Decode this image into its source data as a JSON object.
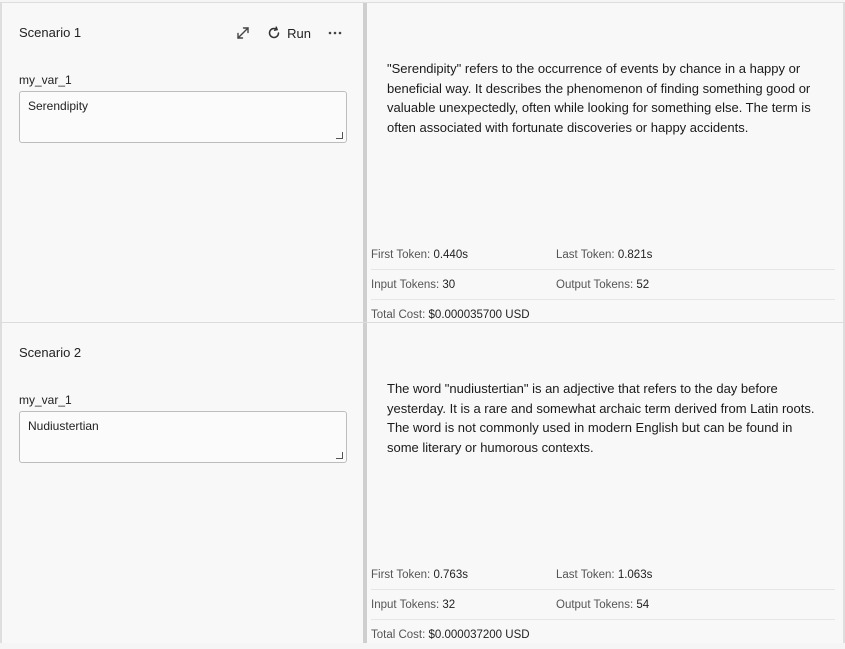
{
  "scenarios": [
    {
      "title": "Scenario 1",
      "actions": {
        "run_label": "Run"
      },
      "variable": {
        "name": "my_var_1",
        "value": "Serendipity"
      },
      "response": "\"Serendipity\" refers to the occurrence of events by chance in a happy or beneficial way. It describes the phenomenon of finding something good or valuable unexpectedly, often while looking for something else. The term is often associated with fortunate discoveries or happy accidents.",
      "metrics": {
        "first_token_label": "First Token:",
        "first_token": "0.440s",
        "last_token_label": "Last Token:",
        "last_token": "0.821s",
        "input_tokens_label": "Input Tokens:",
        "input_tokens": "30",
        "output_tokens_label": "Output Tokens:",
        "output_tokens": "52",
        "total_cost_label": "Total Cost:",
        "total_cost": "$0.000035700 USD"
      }
    },
    {
      "title": "Scenario 2",
      "variable": {
        "name": "my_var_1",
        "value": "Nudiustertian"
      },
      "response": "The word \"nudiustertian\" is an adjective that refers to the day before yesterday. It is a rare and somewhat archaic term derived from Latin roots. The word is not commonly used in modern English but can be found in some literary or humorous contexts.",
      "metrics": {
        "first_token_label": "First Token:",
        "first_token": "0.763s",
        "last_token_label": "Last Token:",
        "last_token": "1.063s",
        "input_tokens_label": "Input Tokens:",
        "input_tokens": "32",
        "output_tokens_label": "Output Tokens:",
        "output_tokens": "54",
        "total_cost_label": "Total Cost:",
        "total_cost": "$0.000037200 USD"
      }
    }
  ]
}
